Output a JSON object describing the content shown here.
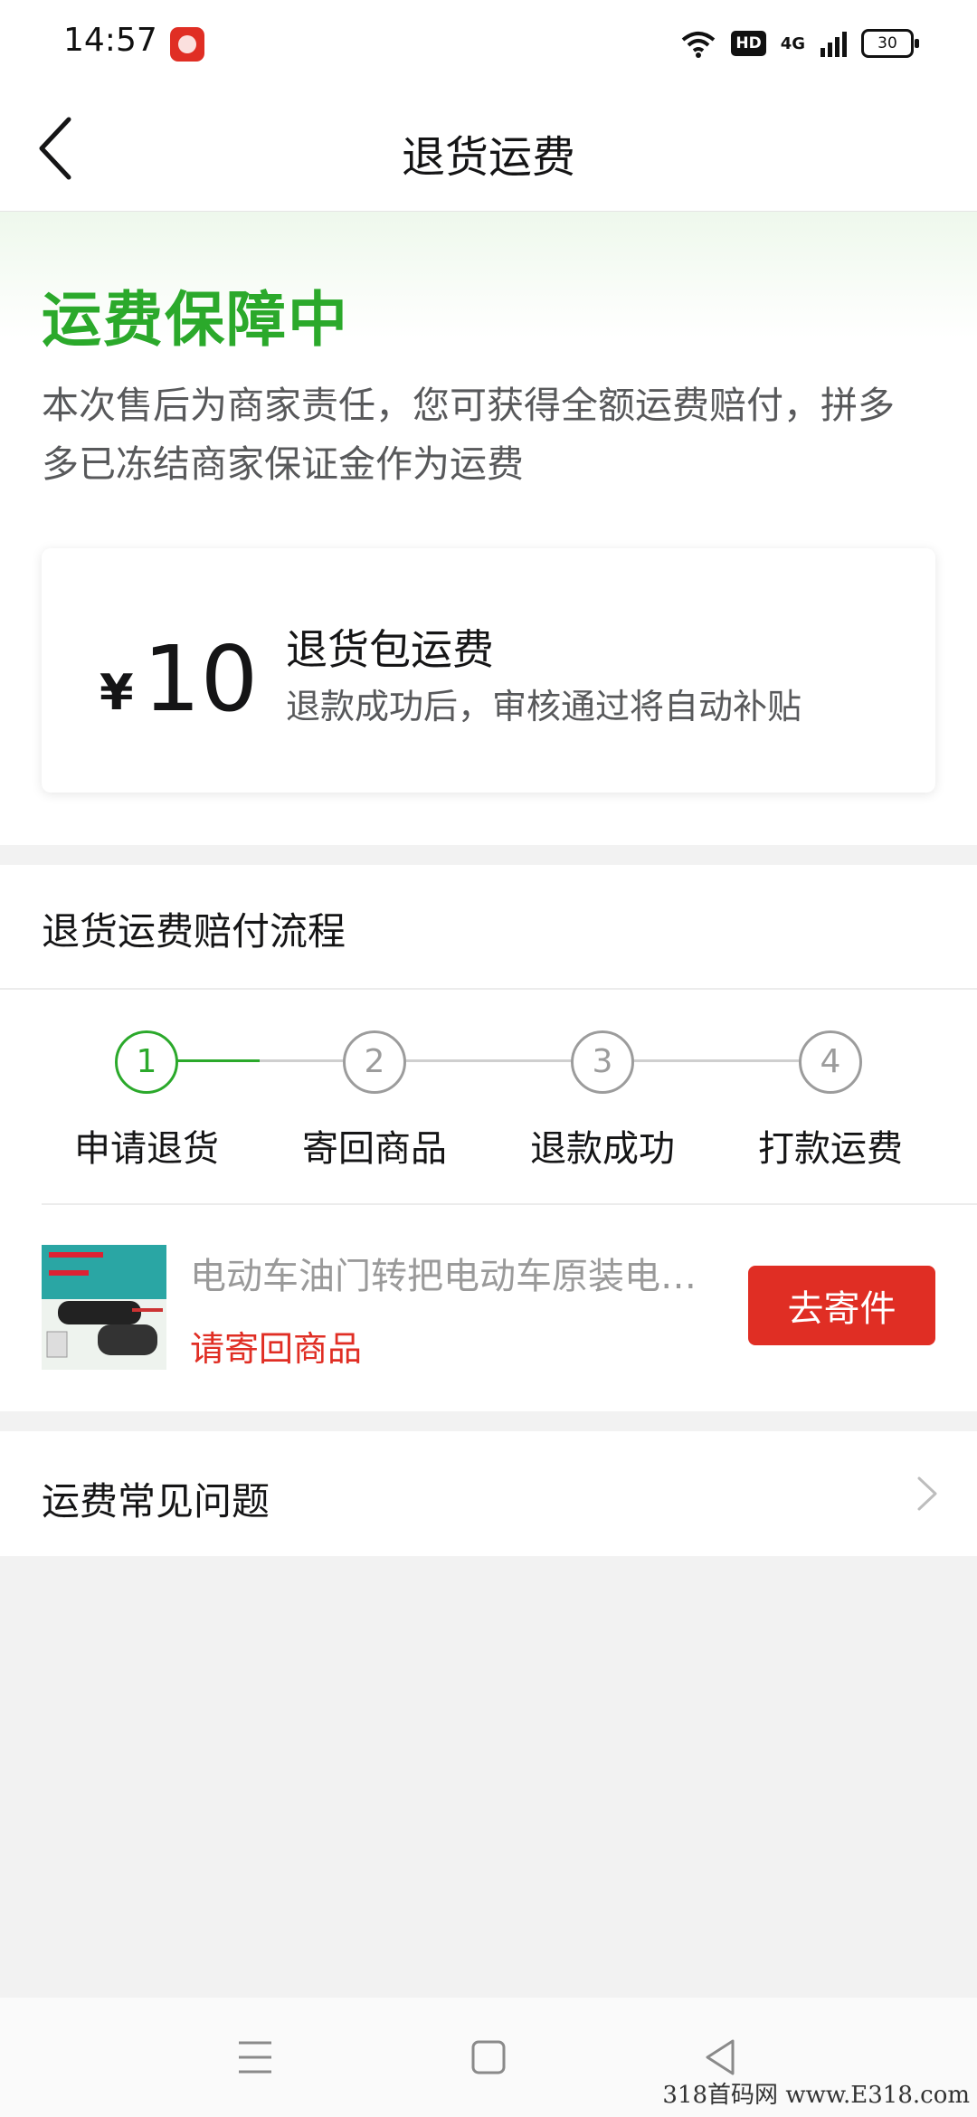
{
  "status_bar": {
    "time": "14:57",
    "network": "4G",
    "hd": "HD",
    "battery": "30"
  },
  "nav": {
    "title": "退货运费"
  },
  "hero": {
    "title": "运费保障中",
    "title_color": "#2ba92b",
    "description": "本次售后为商家责任，您可获得全额运费赔付，拼多多已冻结商家保证金作为运费"
  },
  "compensation_card": {
    "currency": "¥",
    "amount": "10",
    "title": "退货包运费",
    "subtitle": "退款成功后，审核通过将自动补贴"
  },
  "flow": {
    "heading": "退货运费赔付流程",
    "current_step": 1,
    "steps": [
      {
        "number": "1",
        "label": "申请退货"
      },
      {
        "number": "2",
        "label": "寄回商品"
      },
      {
        "number": "3",
        "label": "退款成功"
      },
      {
        "number": "4",
        "label": "打款运费"
      }
    ]
  },
  "product": {
    "name": "电动车油门转把电动车原装电…",
    "status": "请寄回商品",
    "status_color": "#e02e24",
    "action_label": "去寄件"
  },
  "faq": {
    "label": "运费常见问题"
  },
  "watermark": "318首码网 www.E318.com"
}
